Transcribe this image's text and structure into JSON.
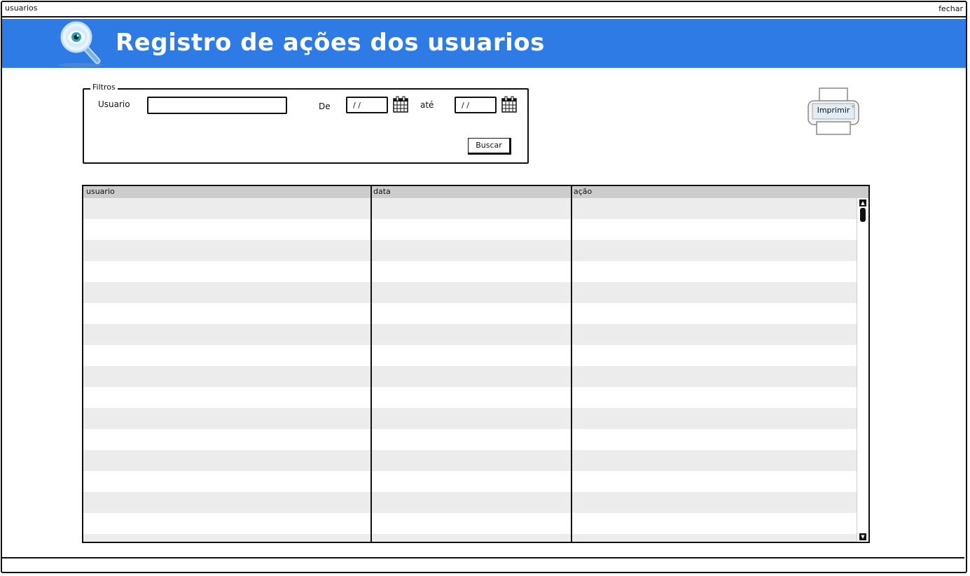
{
  "window": {
    "title": "usuarios",
    "close_label": "fechar"
  },
  "header": {
    "title": "Registro de ações dos usuarios",
    "icon": "magnifier-icon",
    "bg_color": "#2f7be6"
  },
  "filters": {
    "legend": "Filtros",
    "user_label": "Usuario",
    "user_value": "",
    "from_label": "De",
    "from_value": "/ /",
    "to_label": "até",
    "to_value": "/ /",
    "search_button": "Buscar"
  },
  "print": {
    "label": "Imprimir",
    "icon": "printer-icon"
  },
  "table": {
    "columns": [
      "usuario",
      "data",
      "ação"
    ],
    "rows": []
  }
}
